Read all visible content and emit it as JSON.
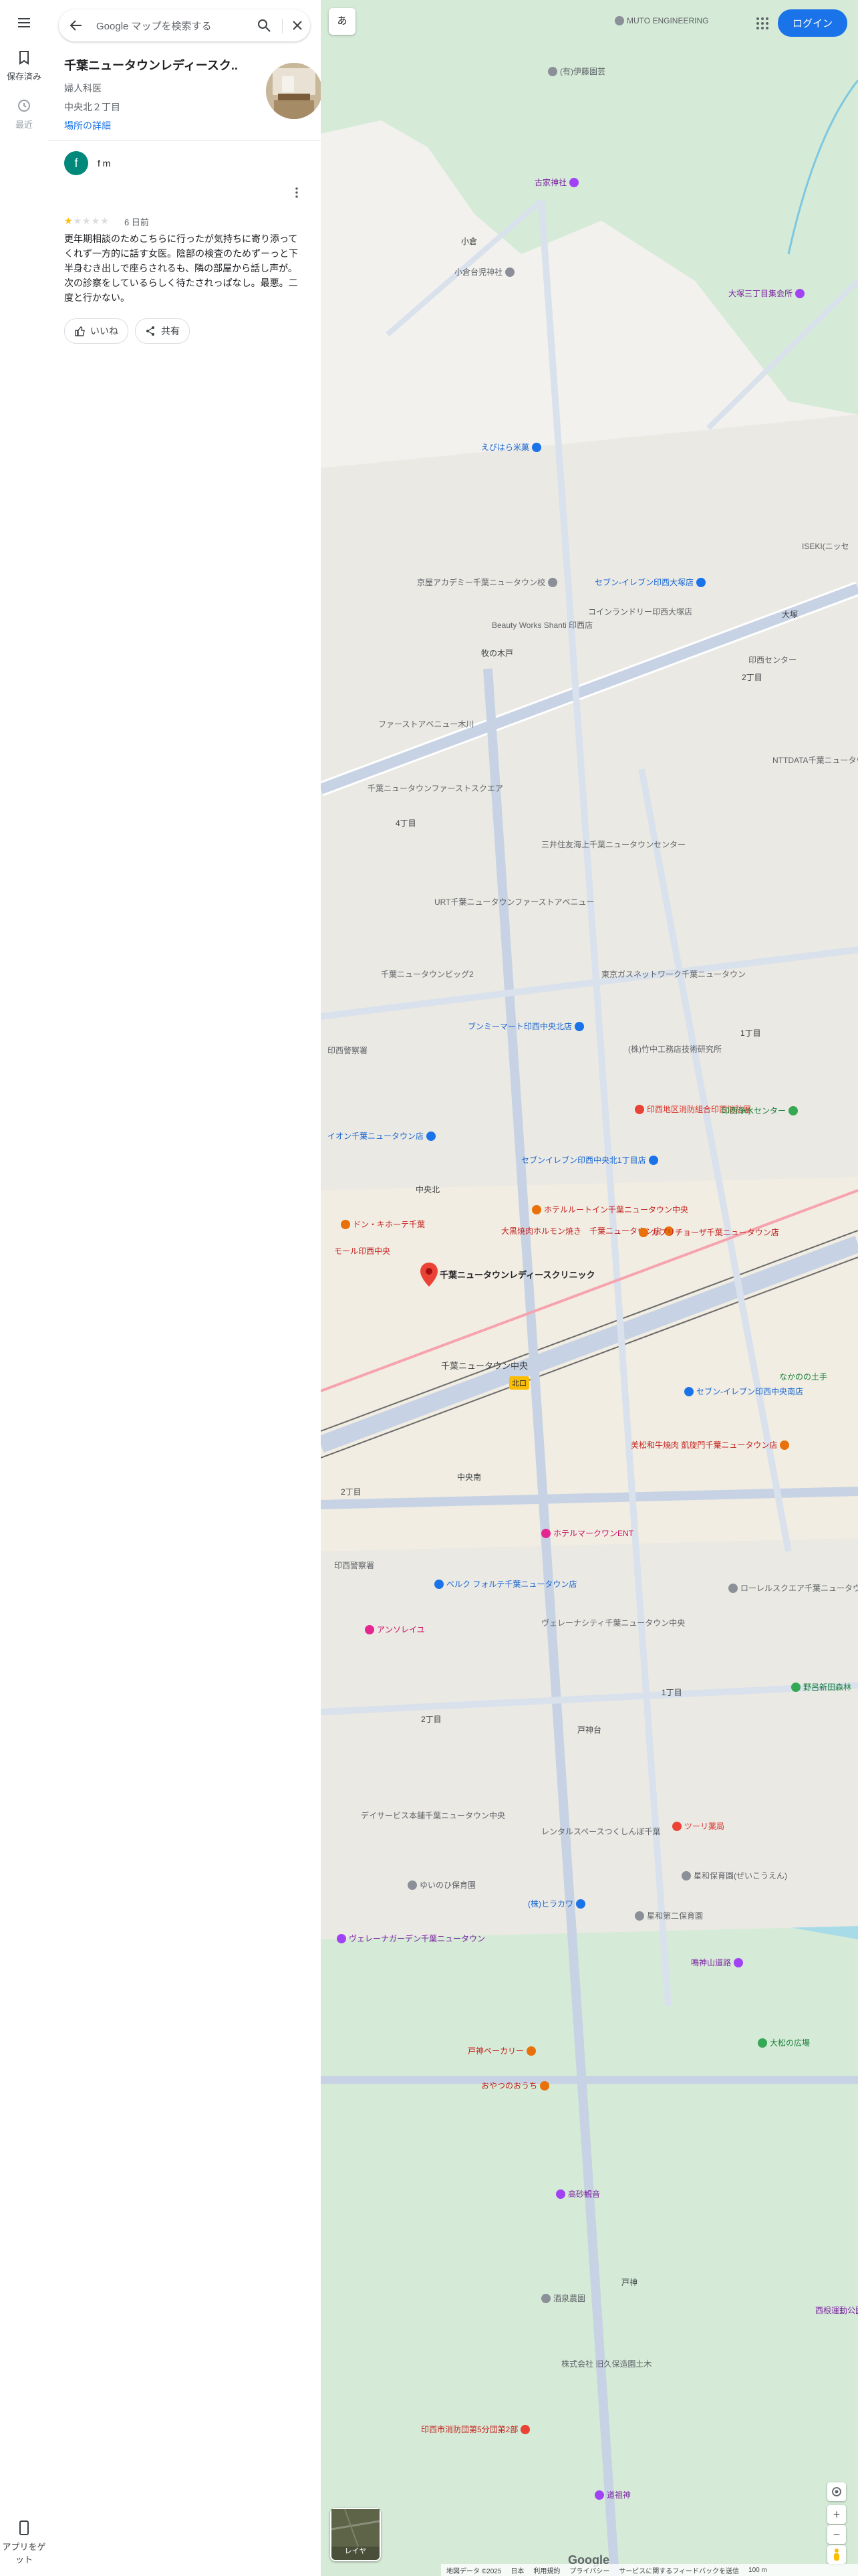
{
  "rail": {
    "saved_label": "保存済み",
    "recent_label": "最近",
    "app_label_1": "アプリをゲ",
    "app_label_2": "ット"
  },
  "search": {
    "placeholder": "Google マップを検索する"
  },
  "place": {
    "name": "千葉ニュータウンレディースク...",
    "category": "婦人科医",
    "address": "中央北２丁目",
    "details_link": "場所の詳細"
  },
  "review": {
    "avatar_letter": "f",
    "reviewer": "f m",
    "rating": 1,
    "max_rating": 5,
    "date": "6 日前",
    "text": "更年期相談のためこちらに行ったが気持ちに寄り添ってくれず一方的に話す女医。陰部の検査のためずーっと下半身むき出しで座らされるも、隣の部屋から話し声が。次の診察をしているらしく待たされっぱなし。最悪。二度と行かない。",
    "like_label": "いいね",
    "share_label": "共有"
  },
  "map": {
    "lang_label": "あ",
    "login_label": "ログイン",
    "layer_label": "レイヤ",
    "google_logo": "Google",
    "selected_place": "千葉ニュータウンレディースクリニック",
    "station": "千葉ニュータウン中央",
    "station_badge": "北口",
    "labels": [
      "MUTO ENGINEERING",
      "(有)伊藤園芸",
      "古家神社",
      "小倉",
      "小倉台児神社",
      "大塚三丁目集会所",
      "えびはら米菓",
      "京屋アカデミー千葉ニュータウン校",
      "セブン-イレブン印西大塚店",
      "コインランドリー印西大塚店",
      "Beauty Works Shanti 印西店",
      "牧の木戸",
      "ISEKI(ニッセ",
      "大塚",
      "2丁目",
      "印西センター",
      "ファーストアベニュー木川",
      "NTTDATA千葉ニュータウン",
      "千葉ニュータウンファーストスクエア",
      "4丁目",
      "三井住友海上千葉ニュータウンセンター",
      "URT千葉ニュータウンファーストアベニュー",
      "千葉ニュータウンビッグ2",
      "東京ガスネットワーク千葉ニュータウン",
      "ブンミーマート印西中央北店",
      "(株)竹中工務店技術研究所",
      "1丁目",
      "印西警察署",
      "印西地区消防組合印西消防署",
      "印西浄水センター",
      "イオン千葉ニュータウン店",
      "中央北",
      "セブンイレブン印西中央北1丁目店",
      "ホテルルートイン千葉ニュータウン中央",
      "大黒焼肉ホルモン焼き　千葉ニュータウン店",
      "カプリチョーザ千葉ニュータウン店",
      "ドン・キホーテ千葉",
      "モール印西中央",
      "なかのの土手",
      "セブン-イレブン印西中央南店",
      "美松和牛焼肉 凱旋門千葉ニュータウン店",
      "中央南",
      "2丁目",
      "ホテルマークワンENT",
      "印西警察署",
      "ベルク フォルテ千葉ニュータウン店",
      "アンソレイユ",
      "ヴェレーナシティ千葉ニュータウン中央",
      "ローレルスクエア千葉ニュータウン中央",
      "野呂新田森林",
      "2丁目",
      "1丁目",
      "戸神台",
      "デイサービス本舗千葉ニュータウン中央",
      "レンタルスペースつくしんぼ千葉",
      "ツーリ薬局",
      "ゆいのひ保育園",
      "星和保育園(ぜいこうえん)",
      "(株)ヒラカワ",
      "星和第二保育園",
      "ヴェレーナガーデン千葉ニュータウン",
      "鳴神山道路",
      "大松の広場",
      "戸神ベーカリー",
      "おやつのおうち",
      "高砂観音",
      "戸神",
      "酒泉農園",
      "株式会社 旧久保造園土木",
      "印西市消防団第5分団第2部",
      "道祖神",
      "西根運動公園"
    ],
    "footer": [
      "地図データ ©2025",
      "日本",
      "利用規約",
      "プライバシー",
      "サービスに関するフィードバックを送信",
      "100 m"
    ]
  }
}
